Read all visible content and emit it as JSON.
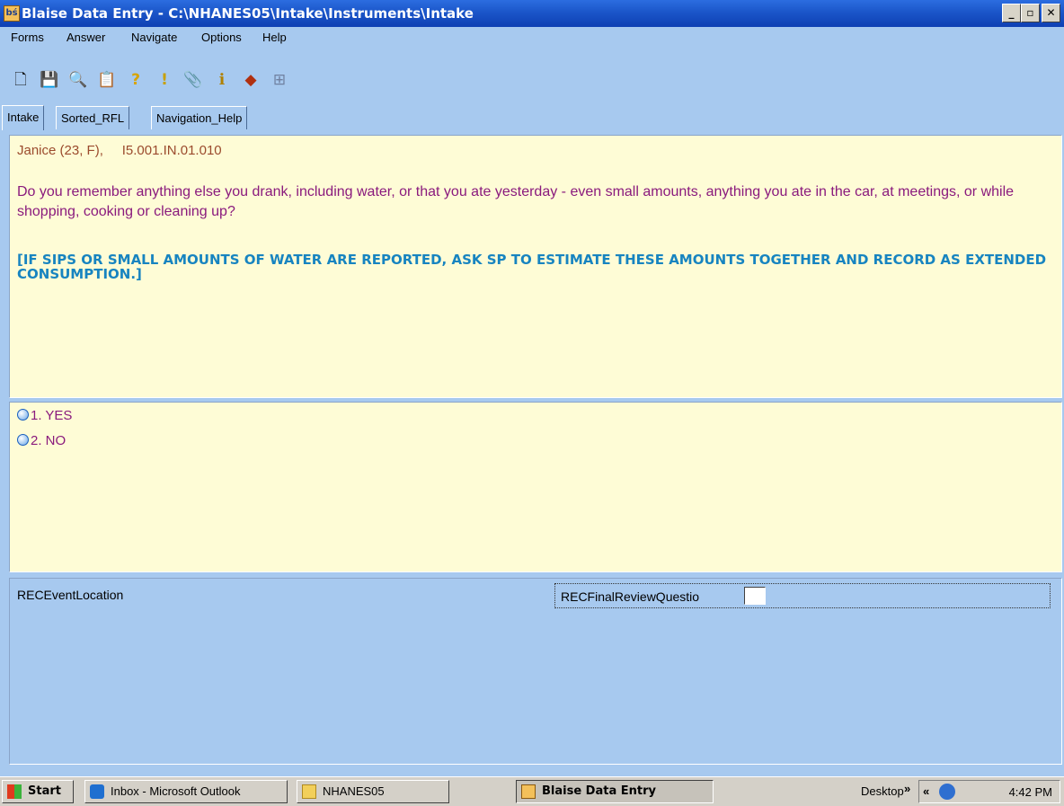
{
  "window": {
    "app_icon_text": "bś",
    "title": "Blaise Data Entry - C:\\NHANES05\\Intake\\Instruments\\Intake",
    "buttons": {
      "minimize": "_",
      "restore": "▫",
      "close": "✕"
    }
  },
  "menu": [
    "Forms",
    "Answer",
    "Navigate",
    "Options",
    "Help"
  ],
  "toolbar": [
    {
      "icon": "new-page-icon",
      "glyph": "🗋"
    },
    {
      "icon": "save-icon",
      "glyph": "💾"
    },
    {
      "icon": "find-icon",
      "glyph": "🔍"
    },
    {
      "icon": "lookup-icon",
      "glyph": "📋"
    },
    {
      "icon": "help-icon",
      "glyph": "?"
    },
    {
      "icon": "warning-icon",
      "glyph": "!"
    },
    {
      "icon": "attach-icon",
      "glyph": "📎"
    },
    {
      "icon": "info-icon",
      "glyph": "ℹ"
    },
    {
      "icon": "remark-icon",
      "glyph": "◆"
    },
    {
      "icon": "tree-icon",
      "glyph": "⊞"
    }
  ],
  "tabs": [
    "Intake",
    "Sorted_RFL",
    "Navigation_Help"
  ],
  "question": {
    "respondent": "Janice (23, F),     I5.001.IN.01.010",
    "text": "Do you remember anything else you drank, including water, or that you ate yesterday - even small amounts, anything you ate in the car, at meetings, or while shopping, cooking or cleaning up?",
    "instruction": "[IF SIPS OR SMALL AMOUNTS OF WATER ARE REPORTED, ASK SP TO ESTIMATE THESE AMOUNTS TOGETHER AND RECORD AS EXTENDED CONSUMPTION.]"
  },
  "answers": [
    {
      "label": "1.  YES"
    },
    {
      "label": "2.  NO"
    }
  ],
  "fields": {
    "left": "RECEventLocation",
    "right": "RECFinalReviewQuestio",
    "right_value": ""
  },
  "taskbar": {
    "start": "Start",
    "tasks": [
      "Inbox - Microsoft Outlook",
      "NHANES05",
      "Blaise Data Entry"
    ],
    "desktop": "Desktop",
    "clock": "4:42 PM"
  },
  "colors": {
    "background": "#a7c9ef",
    "panel": "#fefcd6",
    "question_text": "#8a1a7d",
    "instruction_text": "#1784c0",
    "titlebar": "#1b56c9"
  }
}
